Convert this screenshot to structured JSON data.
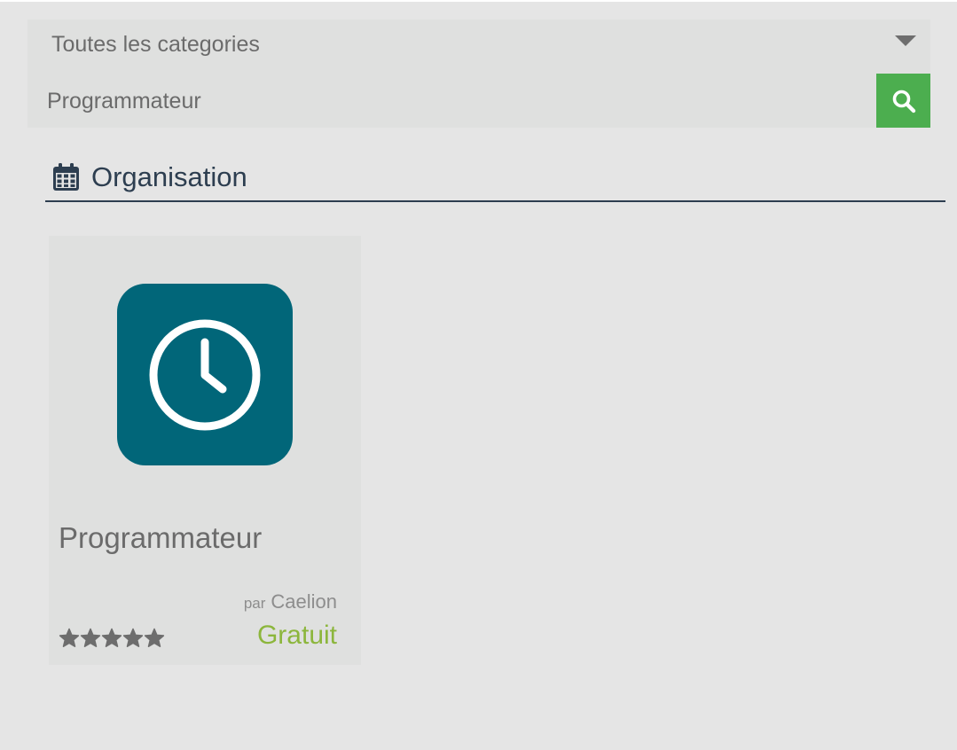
{
  "search": {
    "category_selected": "Toutes les categories",
    "query_value": "Programmateur",
    "button_icon": "search-icon",
    "button_color": "#4cae4f"
  },
  "section": {
    "icon": "calendar-icon",
    "title": "Organisation",
    "color": "#2d3e50"
  },
  "apps": [
    {
      "icon": "clock-icon",
      "icon_bg": "#016679",
      "name": "Programmateur",
      "author_prefix": "par",
      "author": "Caelion",
      "price": "Gratuit",
      "price_color": "#8cb63c",
      "rating": 5,
      "rating_max": 5
    }
  ]
}
